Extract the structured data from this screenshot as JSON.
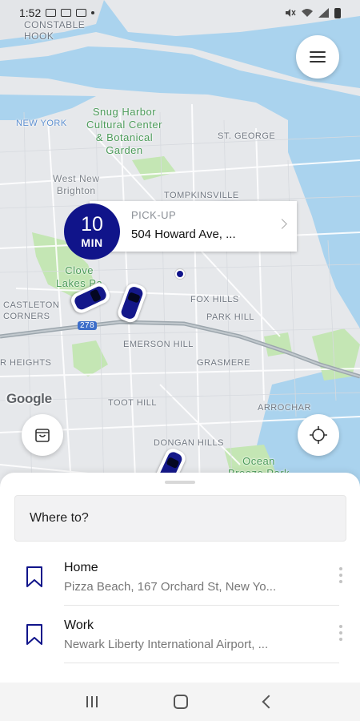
{
  "status_bar": {
    "time": "1:52"
  },
  "map": {
    "labels": {
      "constable_hook": "CONSTABLE\nHOOK",
      "snug_harbor": "Snug Harbor\nCultural Center\n& Botanical\nGarden",
      "st_george": "ST. GEORGE",
      "west_new_brighton": "West New\nBrighton",
      "tompkinsville": "TOMPKINSVILLE",
      "clove_lakes": "Clove\nLakes Pa",
      "castleton_corners": "CASTLETON\nCORNERS",
      "fox_hills": "FOX HILLS",
      "park_hill": "PARK HILL",
      "emerson_hill": "EMERSON HILL",
      "heights": "R HEIGHTS",
      "grasmere": "GRASMERE",
      "toot_hill": "TOOT HILL",
      "arrochar": "ARROCHAR",
      "dongan_hills": "DONGAN HILLS",
      "ocean_breeze": "Ocean\nBreeze Park",
      "new_york": "NEW YORK",
      "route_278": "278"
    },
    "google_logo": "Google"
  },
  "pickup": {
    "eta_number": "10",
    "eta_unit": "MIN",
    "title": "PICK-UP",
    "address": "504 Howard Ave, ..."
  },
  "search": {
    "placeholder": "Where to?"
  },
  "favorites": [
    {
      "title": "Home",
      "address": "Pizza Beach, 167 Orchard St, New Yo..."
    },
    {
      "title": "Work",
      "address": "Newark Liberty International Airport, ..."
    }
  ],
  "colors": {
    "brand": "#10148a",
    "water": "#aad3ee",
    "park": "#c4e6b4"
  },
  "icons": {
    "menu": "hamburger-icon",
    "bag": "shopping-bag-icon",
    "locate": "crosshair-icon",
    "bookmark": "bookmark-icon",
    "more": "more-vertical-icon"
  }
}
